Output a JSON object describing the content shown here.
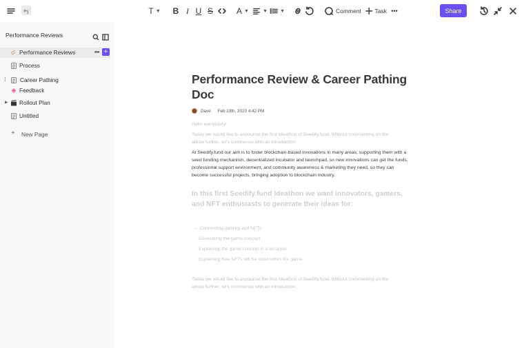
{
  "toolbar": {
    "text_style_icon": "T",
    "bold_icon": "B",
    "italic_icon": "I",
    "underline_icon": "U",
    "strikethrough_icon": "S",
    "font_color_icon": "A",
    "comment_label": "Comment",
    "task_label": "Task",
    "share_label": "Share",
    "accent_color": "#6c4ff0"
  },
  "sidebar": {
    "title": "Performance Reviews",
    "items": [
      {
        "label": "Performance Reviews",
        "icon": "sparkle-icon"
      },
      {
        "label": "Process",
        "icon": "document-icon"
      },
      {
        "label": "Career Pathing",
        "icon": "document-icon"
      },
      {
        "label": "Feedback",
        "icon": "flower-icon"
      },
      {
        "label": "Rollout Plan",
        "icon": "clapperboard-icon"
      },
      {
        "label": "Untitled",
        "icon": "document-icon"
      }
    ],
    "new_page_label": "New Page",
    "more_label": "•••",
    "add_label": "+"
  },
  "doc": {
    "title": "Performance Review & Career Pathing Doc",
    "author": "Dave",
    "date": "Feb 23th, 2020  4:42 PM",
    "greeting": "Hello everybody!",
    "intro_lines": [
      "Today we would like to announce the first Ideathon of Seedify.fund. Without commenting on the",
      "article further, let's commence with an introduction:"
    ],
    "body": "At Seedify.fund our aim is to foster blockchain-based innovations in many areas, supporting them with a seed funding mechanism, decentralized incubator and launchpad, so new innovations can get the funds, professional support environment, and community awareness & marketing they need, so they can become successful projects, bringing adoption to blockchain industry.",
    "subheading": "In this first Seedify.fund Ideathon we want innovators, gamers, and NFT enthusiasts to generate their ideas for:",
    "list": [
      "Connecting gaming and NFTs",
      "Generating the game concept",
      "Explaining the game concept in a scrapper",
      "Explaining how NFTs will be used within the game"
    ],
    "outro_lines": [
      "Today we would like to announce the first Ideathon of Seedify.fund. Without commenting on the",
      "article further, let's commence with an introduction:"
    ]
  }
}
